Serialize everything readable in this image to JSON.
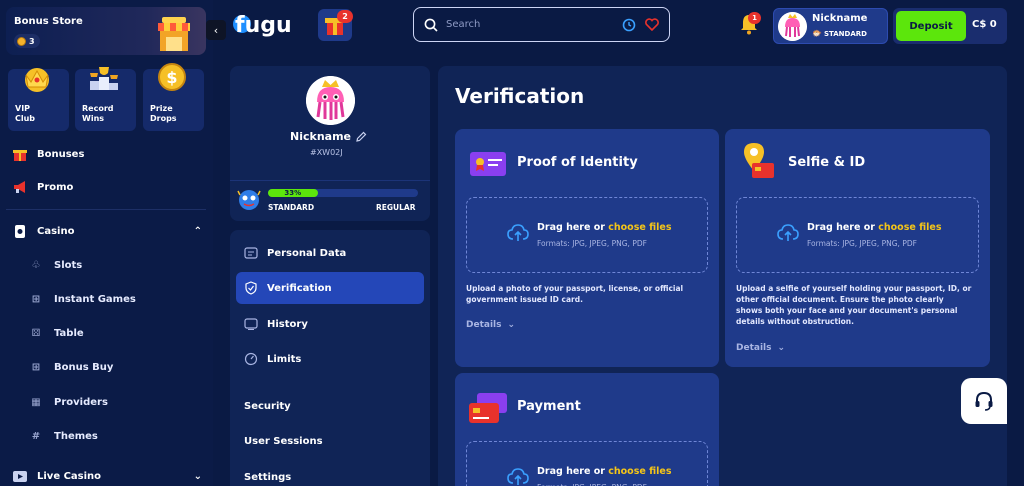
{
  "sidebar": {
    "bonus_store": {
      "title": "Bonus Store",
      "count": "3"
    },
    "tiles": [
      {
        "label1": "VIP",
        "label2": "Club"
      },
      {
        "label1": "Record",
        "label2": "Wins"
      },
      {
        "label1": "Prize",
        "label2": "Drops"
      }
    ],
    "bonuses": "Bonuses",
    "promo": "Promo",
    "casino": "Casino",
    "casino_items": [
      "Slots",
      "Instant Games",
      "Table",
      "Bonus Buy",
      "Providers",
      "Themes"
    ],
    "live_casino": "Live Casino"
  },
  "header": {
    "logo": "fugu",
    "gift_count": "2",
    "search_placeholder": "Search",
    "notifications": "1",
    "user": {
      "nickname": "Nickname",
      "level": "STANDARD"
    },
    "deposit": "Deposit",
    "balance": "C$ 0"
  },
  "profile": {
    "nickname": "Nickname",
    "id": "#XW02J",
    "progress_label": "33%",
    "progress": 0.33,
    "level_current": "STANDARD",
    "level_next": "REGULAR"
  },
  "menu": {
    "items": [
      "Personal Data",
      "Verification",
      "History",
      "Limits"
    ],
    "active": "Verification",
    "plain": [
      "Security",
      "User Sessions",
      "Settings"
    ]
  },
  "main": {
    "title": "Verification",
    "drop_text": "Drag here or ",
    "choose_files": "choose files",
    "formats": "Formats: JPG, JPEG, PNG, PDF",
    "details": "Details",
    "cards": {
      "identity": {
        "title": "Proof of Identity",
        "desc_lines": [
          "Upload a photo of your passport, license, or official",
          "government issued ID card."
        ]
      },
      "selfie": {
        "title": "Selfie & ID",
        "desc_lines": [
          "Upload a selfie of yourself holding your passport, ID, or",
          "other official document. Ensure the photo clearly",
          "shows both your face and your document's personal",
          "details without obstruction."
        ]
      },
      "payment": {
        "title": "Payment"
      }
    }
  },
  "colors": {
    "accent": "#5ce60c",
    "highlight": "#f5c518",
    "panel": "#102456",
    "card": "#1f3a8a",
    "bg": "#0a1a44"
  }
}
